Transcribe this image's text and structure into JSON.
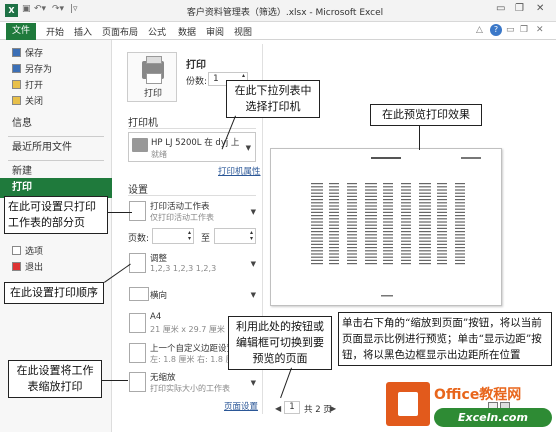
{
  "window": {
    "title": "客户资料管理表（筛选）.xlsx - Microsoft Excel",
    "logo": "X"
  },
  "ribbon": {
    "tabs": [
      "文件",
      "开始",
      "插入",
      "页面布局",
      "公式",
      "数据",
      "审阅",
      "视图"
    ]
  },
  "sidebar": {
    "items": [
      {
        "label": "保存",
        "icon": "save-icon"
      },
      {
        "label": "另存为",
        "icon": "save-as-icon"
      },
      {
        "label": "打开",
        "icon": "open-folder-icon"
      },
      {
        "label": "关闭",
        "icon": "close-folder-icon"
      }
    ],
    "sections": [
      "信息",
      "最近所用文件",
      "新建",
      "打印"
    ],
    "bottom_items": [
      {
        "label": "选项",
        "icon": "options-icon"
      },
      {
        "label": "退出",
        "icon": "exit-icon"
      }
    ]
  },
  "print": {
    "heading": "打印",
    "button_label": "打印",
    "copies_label": "份数:",
    "copies_value": "1"
  },
  "printer": {
    "heading": "打印机",
    "name": "HP LJ 5200L 在 dyj 上",
    "status": "就绪",
    "properties_link": "打印机属性"
  },
  "settings": {
    "heading": "设置",
    "scope_title": "打印活动工作表",
    "scope_desc": "仅打印活动工作表",
    "pages_label": "页数:",
    "pages_to": "至",
    "collate_title": "调整",
    "collate_desc": "1,2,3    1,2,3    1,2,3",
    "orientation": "横向",
    "paper_title": "A4",
    "paper_desc": "21 厘米 x 29.7 厘米",
    "margins_title": "上一个自定义边距设置",
    "margins_desc": "左: 1.8 厘米    右: 1.8 厘米",
    "scaling_title": "无缩放",
    "scaling_desc": "打印实际大小的工作表",
    "page_setup_link": "页面设置"
  },
  "pager": {
    "current": "1",
    "total": "共 2 页"
  },
  "callouts": {
    "printer_dropdown": "在此下拉列表中选择打印机",
    "preview_effect": "在此预览打印效果",
    "partial_pages": "在此可设置只打印工作表的部分页",
    "print_order": "在此设置打印顺序",
    "page_nav": "利用此处的按钮或编辑框可切换到要预览的页面",
    "zoom_margins": "单击右下角的“缩放到页面”按钮，将以当前页面显示比例进行预览；单击“显示边距”按钮，将以黑色边框显示出边距所在位置",
    "scaling": "在此设置将工作表缩放打印"
  },
  "badge": {
    "top": "Office教程网",
    "bottom": "Exceln.com"
  },
  "colors": {
    "accent": "#1f7a3c",
    "badge_orange": "#e25a1c",
    "badge_green": "#2e8b34"
  }
}
